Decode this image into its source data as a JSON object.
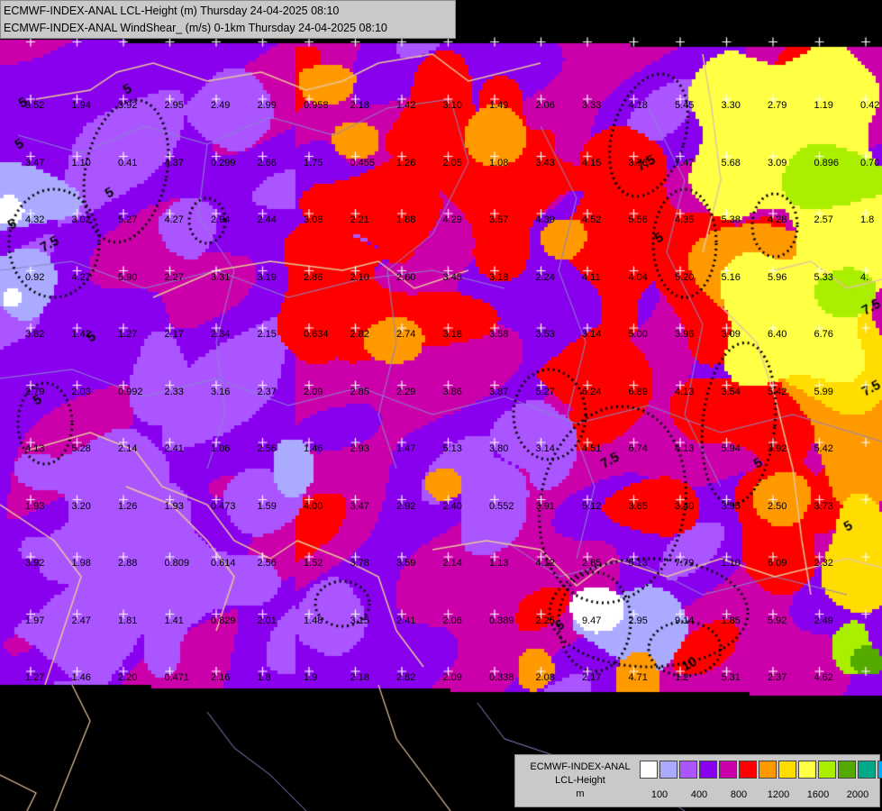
{
  "header": {
    "line1": "ECMWF-INDEX-ANAL LCL-Height (m) Thursday 24-04-2025 08:10",
    "line2": "ECMWF-INDEX-ANAL WindShear_ (m/s) 0-1km Thursday 24-04-2025 08:10"
  },
  "legend": {
    "model": "ECMWF-INDEX-ANAL",
    "parameter": "LCL-Height",
    "unit": "m",
    "colors": [
      "#ffffff",
      "#aaaaff",
      "#aa55ff",
      "#8800ee",
      "#cc00aa",
      "#ff0000",
      "#ff9900",
      "#ffdd00",
      "#ffff44",
      "#aaee00",
      "#55aa00",
      "#00aa88",
      "#00aaff"
    ],
    "tick_labels": [
      "100",
      "400",
      "800",
      "1200",
      "1600",
      "2000"
    ]
  },
  "palette": {
    "background": "#000000",
    "border_country": "#e8c79a",
    "border_region": "#8888cc",
    "grid_marker": "#ffffff",
    "contour": "#000000"
  },
  "map_values": [
    {
      "v": "3.52",
      "r": 0,
      "c": 0
    },
    {
      "v": "1.94",
      "r": 0,
      "c": 1
    },
    {
      "v": "3.92",
      "r": 0,
      "c": 2
    },
    {
      "v": "2.95",
      "r": 0,
      "c": 3
    },
    {
      "v": "2.49",
      "r": 0,
      "c": 4
    },
    {
      "v": "2.99",
      "r": 0,
      "c": 5
    },
    {
      "v": "0.958",
      "r": 0,
      "c": 6
    },
    {
      "v": "2.18",
      "r": 0,
      "c": 7
    },
    {
      "v": "1.42",
      "r": 0,
      "c": 8
    },
    {
      "v": "3.10",
      "r": 0,
      "c": 9
    },
    {
      "v": "1.49",
      "r": 0,
      "c": 10
    },
    {
      "v": "2.06",
      "r": 0,
      "c": 11
    },
    {
      "v": "3.33",
      "r": 0,
      "c": 12
    },
    {
      "v": "4.18",
      "r": 0,
      "c": 13
    },
    {
      "v": "5.45",
      "r": 0,
      "c": 14
    },
    {
      "v": "3.30",
      "r": 0,
      "c": 15
    },
    {
      "v": "2.79",
      "r": 0,
      "c": 16
    },
    {
      "v": "1.19",
      "r": 0,
      "c": 17
    },
    {
      "v": "0.42",
      "r": 0,
      "c": 18
    },
    {
      "v": "3.47",
      "r": 1,
      "c": 0
    },
    {
      "v": "1.10",
      "r": 1,
      "c": 1
    },
    {
      "v": "0.41",
      "r": 1,
      "c": 2
    },
    {
      "v": "4.37",
      "r": 1,
      "c": 3
    },
    {
      "v": "0.299",
      "r": 1,
      "c": 4
    },
    {
      "v": "2.66",
      "r": 1,
      "c": 5
    },
    {
      "v": "1.75",
      "r": 1,
      "c": 6
    },
    {
      "v": "0.455",
      "r": 1,
      "c": 7
    },
    {
      "v": "1.26",
      "r": 1,
      "c": 8
    },
    {
      "v": "2.05",
      "r": 1,
      "c": 9
    },
    {
      "v": "1.08",
      "r": 1,
      "c": 10
    },
    {
      "v": "3.43",
      "r": 1,
      "c": 11
    },
    {
      "v": "4.15",
      "r": 1,
      "c": 12
    },
    {
      "v": "3.76",
      "r": 1,
      "c": 13
    },
    {
      "v": "7.47",
      "r": 1,
      "c": 14
    },
    {
      "v": "5.68",
      "r": 1,
      "c": 15
    },
    {
      "v": "3.09",
      "r": 1,
      "c": 16
    },
    {
      "v": "0.896",
      "r": 1,
      "c": 17
    },
    {
      "v": "0.70",
      "r": 1,
      "c": 18
    },
    {
      "v": "4.32",
      "r": 2,
      "c": 0
    },
    {
      "v": "3.02",
      "r": 2,
      "c": 1
    },
    {
      "v": "5.27",
      "r": 2,
      "c": 2
    },
    {
      "v": "4.27",
      "r": 2,
      "c": 3
    },
    {
      "v": "2.94",
      "r": 2,
      "c": 4
    },
    {
      "v": "2.44",
      "r": 2,
      "c": 5
    },
    {
      "v": "3.08",
      "r": 2,
      "c": 6
    },
    {
      "v": "2.21",
      "r": 2,
      "c": 7
    },
    {
      "v": "1.88",
      "r": 2,
      "c": 8
    },
    {
      "v": "4.29",
      "r": 2,
      "c": 9
    },
    {
      "v": "3.57",
      "r": 2,
      "c": 10
    },
    {
      "v": "4.39",
      "r": 2,
      "c": 11
    },
    {
      "v": "4.52",
      "r": 2,
      "c": 12
    },
    {
      "v": "5.56",
      "r": 2,
      "c": 13
    },
    {
      "v": "4.35",
      "r": 2,
      "c": 14
    },
    {
      "v": "5.38",
      "r": 2,
      "c": 15
    },
    {
      "v": "4.28",
      "r": 2,
      "c": 16
    },
    {
      "v": "2.57",
      "r": 2,
      "c": 17
    },
    {
      "v": "1.8",
      "r": 2,
      "c": 18
    },
    {
      "v": "0.92",
      "r": 3,
      "c": 0
    },
    {
      "v": "4.27",
      "r": 3,
      "c": 1
    },
    {
      "v": "5.90",
      "r": 3,
      "c": 2
    },
    {
      "v": "2.27",
      "r": 3,
      "c": 3
    },
    {
      "v": "3.31",
      "r": 3,
      "c": 4
    },
    {
      "v": "3.19",
      "r": 3,
      "c": 5
    },
    {
      "v": "2.86",
      "r": 3,
      "c": 6
    },
    {
      "v": "2.10",
      "r": 3,
      "c": 7
    },
    {
      "v": "2.60",
      "r": 3,
      "c": 8
    },
    {
      "v": "3.45",
      "r": 3,
      "c": 9
    },
    {
      "v": "3.18",
      "r": 3,
      "c": 10
    },
    {
      "v": "2.24",
      "r": 3,
      "c": 11
    },
    {
      "v": "4.11",
      "r": 3,
      "c": 12
    },
    {
      "v": "4.04",
      "r": 3,
      "c": 13
    },
    {
      "v": "5.20",
      "r": 3,
      "c": 14
    },
    {
      "v": "5.16",
      "r": 3,
      "c": 15
    },
    {
      "v": "5.96",
      "r": 3,
      "c": 16
    },
    {
      "v": "5.33",
      "r": 3,
      "c": 17
    },
    {
      "v": "4.",
      "r": 3,
      "c": 18
    },
    {
      "v": "3.82",
      "r": 4,
      "c": 0
    },
    {
      "v": "1.42",
      "r": 4,
      "c": 1
    },
    {
      "v": "1.27",
      "r": 4,
      "c": 2
    },
    {
      "v": "2.17",
      "r": 4,
      "c": 3
    },
    {
      "v": "2.34",
      "r": 4,
      "c": 4
    },
    {
      "v": "2.15",
      "r": 4,
      "c": 5
    },
    {
      "v": "0.634",
      "r": 4,
      "c": 6
    },
    {
      "v": "2.82",
      "r": 4,
      "c": 7
    },
    {
      "v": "2.74",
      "r": 4,
      "c": 8
    },
    {
      "v": "3.18",
      "r": 4,
      "c": 9
    },
    {
      "v": "3.58",
      "r": 4,
      "c": 10
    },
    {
      "v": "3.53",
      "r": 4,
      "c": 11
    },
    {
      "v": "3.14",
      "r": 4,
      "c": 12
    },
    {
      "v": "5.00",
      "r": 4,
      "c": 13
    },
    {
      "v": "3.96",
      "r": 4,
      "c": 14
    },
    {
      "v": "3.09",
      "r": 4,
      "c": 15
    },
    {
      "v": "6.40",
      "r": 4,
      "c": 16
    },
    {
      "v": "6.76",
      "r": 4,
      "c": 17
    },
    {
      "v": "2.79",
      "r": 5,
      "c": 0
    },
    {
      "v": "2.03",
      "r": 5,
      "c": 1
    },
    {
      "v": "0.992",
      "r": 5,
      "c": 2
    },
    {
      "v": "2.33",
      "r": 5,
      "c": 3
    },
    {
      "v": "3.16",
      "r": 5,
      "c": 4
    },
    {
      "v": "2.37",
      "r": 5,
      "c": 5
    },
    {
      "v": "2.09",
      "r": 5,
      "c": 6
    },
    {
      "v": "2.85",
      "r": 5,
      "c": 7
    },
    {
      "v": "2.29",
      "r": 5,
      "c": 8
    },
    {
      "v": "3.86",
      "r": 5,
      "c": 9
    },
    {
      "v": "3.87",
      "r": 5,
      "c": 10
    },
    {
      "v": "5.27",
      "r": 5,
      "c": 11
    },
    {
      "v": "6.24",
      "r": 5,
      "c": 12
    },
    {
      "v": "6.89",
      "r": 5,
      "c": 13
    },
    {
      "v": "4.13",
      "r": 5,
      "c": 14
    },
    {
      "v": "3.54",
      "r": 5,
      "c": 15
    },
    {
      "v": "5.42",
      "r": 5,
      "c": 16
    },
    {
      "v": "5.99",
      "r": 5,
      "c": 17
    },
    {
      "v": "4.13",
      "r": 6,
      "c": 0
    },
    {
      "v": "5.28",
      "r": 6,
      "c": 1
    },
    {
      "v": "2.14",
      "r": 6,
      "c": 2
    },
    {
      "v": "2.41",
      "r": 6,
      "c": 3
    },
    {
      "v": "1.06",
      "r": 6,
      "c": 4
    },
    {
      "v": "2.56",
      "r": 6,
      "c": 5
    },
    {
      "v": "1.46",
      "r": 6,
      "c": 6
    },
    {
      "v": "2.93",
      "r": 6,
      "c": 7
    },
    {
      "v": "1.47",
      "r": 6,
      "c": 8
    },
    {
      "v": "5.13",
      "r": 6,
      "c": 9
    },
    {
      "v": "3.80",
      "r": 6,
      "c": 10
    },
    {
      "v": "3.14",
      "r": 6,
      "c": 11
    },
    {
      "v": "4.51",
      "r": 6,
      "c": 12
    },
    {
      "v": "6.74",
      "r": 6,
      "c": 13
    },
    {
      "v": "4.13",
      "r": 6,
      "c": 14
    },
    {
      "v": "5.94",
      "r": 6,
      "c": 15
    },
    {
      "v": "3.92",
      "r": 6,
      "c": 16
    },
    {
      "v": "5.42",
      "r": 6,
      "c": 17
    },
    {
      "v": "1.93",
      "r": 7,
      "c": 0
    },
    {
      "v": "3.20",
      "r": 7,
      "c": 1
    },
    {
      "v": "1.26",
      "r": 7,
      "c": 2
    },
    {
      "v": "1.93",
      "r": 7,
      "c": 3
    },
    {
      "v": "0.473",
      "r": 7,
      "c": 4
    },
    {
      "v": "1.59",
      "r": 7,
      "c": 5
    },
    {
      "v": "4.00",
      "r": 7,
      "c": 6
    },
    {
      "v": "3.47",
      "r": 7,
      "c": 7
    },
    {
      "v": "2.92",
      "r": 7,
      "c": 8
    },
    {
      "v": "2.40",
      "r": 7,
      "c": 9
    },
    {
      "v": "0.552",
      "r": 7,
      "c": 10
    },
    {
      "v": "3.91",
      "r": 7,
      "c": 11
    },
    {
      "v": "5.12",
      "r": 7,
      "c": 12
    },
    {
      "v": "3.65",
      "r": 7,
      "c": 13
    },
    {
      "v": "3.40",
      "r": 7,
      "c": 14
    },
    {
      "v": "3.95",
      "r": 7,
      "c": 15
    },
    {
      "v": "2.50",
      "r": 7,
      "c": 16
    },
    {
      "v": "3.73",
      "r": 7,
      "c": 17
    },
    {
      "v": "3.92",
      "r": 8,
      "c": 0
    },
    {
      "v": "1.98",
      "r": 8,
      "c": 1
    },
    {
      "v": "2.88",
      "r": 8,
      "c": 2
    },
    {
      "v": "0.809",
      "r": 8,
      "c": 3
    },
    {
      "v": "0.614",
      "r": 8,
      "c": 4
    },
    {
      "v": "2.56",
      "r": 8,
      "c": 5
    },
    {
      "v": "1.52",
      "r": 8,
      "c": 6
    },
    {
      "v": "3.78",
      "r": 8,
      "c": 7
    },
    {
      "v": "3.59",
      "r": 8,
      "c": 8
    },
    {
      "v": "2.14",
      "r": 8,
      "c": 9
    },
    {
      "v": "1.13",
      "r": 8,
      "c": 10
    },
    {
      "v": "4.12",
      "r": 8,
      "c": 11
    },
    {
      "v": "2.85",
      "r": 8,
      "c": 12
    },
    {
      "v": "5.13",
      "r": 8,
      "c": 13
    },
    {
      "v": "7.79",
      "r": 8,
      "c": 14
    },
    {
      "v": "1.10",
      "r": 8,
      "c": 15
    },
    {
      "v": "6.09",
      "r": 8,
      "c": 16
    },
    {
      "v": "2.32",
      "r": 8,
      "c": 17
    },
    {
      "v": "1.97",
      "r": 9,
      "c": 0
    },
    {
      "v": "2.47",
      "r": 9,
      "c": 1
    },
    {
      "v": "1.81",
      "r": 9,
      "c": 2
    },
    {
      "v": "1.41",
      "r": 9,
      "c": 3
    },
    {
      "v": "0.829",
      "r": 9,
      "c": 4
    },
    {
      "v": "2.01",
      "r": 9,
      "c": 5
    },
    {
      "v": "1.48",
      "r": 9,
      "c": 6
    },
    {
      "v": "3.15",
      "r": 9,
      "c": 7
    },
    {
      "v": "2.41",
      "r": 9,
      "c": 8
    },
    {
      "v": "2.06",
      "r": 9,
      "c": 9
    },
    {
      "v": "0.389",
      "r": 9,
      "c": 10
    },
    {
      "v": "2.25",
      "r": 9,
      "c": 11
    },
    {
      "v": "9.47",
      "r": 9,
      "c": 12
    },
    {
      "v": "2.95",
      "r": 9,
      "c": 13
    },
    {
      "v": "9.14",
      "r": 9,
      "c": 14
    },
    {
      "v": "1.85",
      "r": 9,
      "c": 15
    },
    {
      "v": "5.92",
      "r": 9,
      "c": 16
    },
    {
      "v": "2.49",
      "r": 9,
      "c": 17
    },
    {
      "v": "1.27",
      "r": 10,
      "c": 0
    },
    {
      "v": "1.46",
      "r": 10,
      "c": 1
    },
    {
      "v": "2.20",
      "r": 10,
      "c": 2
    },
    {
      "v": "0.471",
      "r": 10,
      "c": 3
    },
    {
      "v": "2.16",
      "r": 10,
      "c": 4
    },
    {
      "v": "1.8",
      "r": 10,
      "c": 5
    },
    {
      "v": "1.9",
      "r": 10,
      "c": 6
    },
    {
      "v": "2.18",
      "r": 10,
      "c": 7
    },
    {
      "v": "2.82",
      "r": 10,
      "c": 8
    },
    {
      "v": "2.09",
      "r": 10,
      "c": 9
    },
    {
      "v": "0.338",
      "r": 10,
      "c": 10
    },
    {
      "v": "2.08",
      "r": 10,
      "c": 11
    },
    {
      "v": "2.17",
      "r": 10,
      "c": 12
    },
    {
      "v": "4.71",
      "r": 10,
      "c": 13
    },
    {
      "v": "1.2",
      "r": 10,
      "c": 14
    },
    {
      "v": "5.31",
      "r": 10,
      "c": 15
    },
    {
      "v": "2.37",
      "r": 10,
      "c": 16
    },
    {
      "v": "4.62",
      "r": 10,
      "c": 17
    }
  ],
  "contour_labels": [
    "5",
    "5",
    "5",
    "7.5",
    "5",
    "5",
    "5",
    "5",
    "7.5",
    "5",
    "7.5",
    "5",
    "7.5",
    "7.5",
    "5",
    "10",
    "5"
  ]
}
